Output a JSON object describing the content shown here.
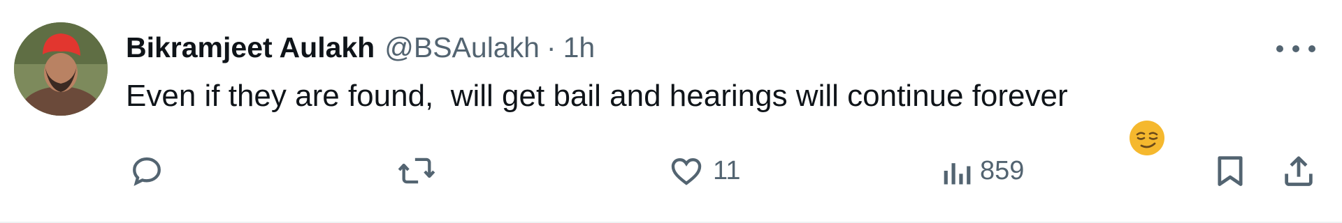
{
  "tweet": {
    "author_name": "Bikramjeet Aulakh",
    "handle": "@BSAulakh",
    "separator": "·",
    "time": "1h",
    "text": "Even if they are found,  will get bail and hearings will continue forever",
    "emoji": "smirking-face-emoji"
  },
  "actions": {
    "reply_count": "",
    "retweet_count": "",
    "like_count": "11",
    "views_count": "859"
  },
  "colors": {
    "text": "#0f1419",
    "secondary": "#536471",
    "divider": "#eff3f4",
    "emoji": "#f5b82e"
  }
}
